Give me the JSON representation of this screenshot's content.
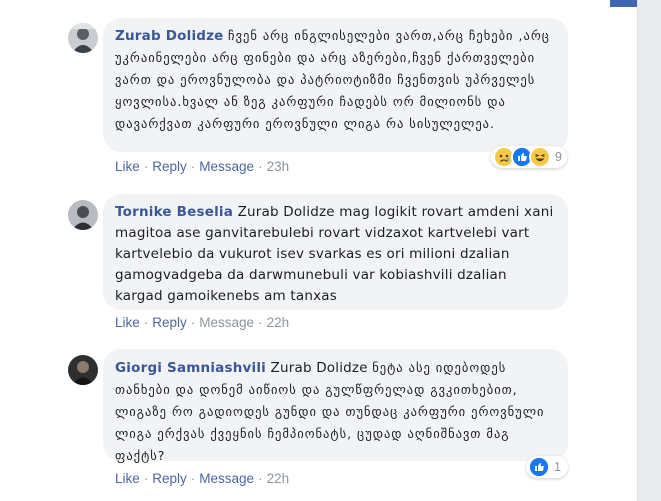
{
  "comments": [
    {
      "author": "Zurab Dolidze",
      "text": "ჩვენ არც ინგლისელები ვართ,არც ჩეხები ,არც უკრაინელები არც ფინები და არც აზერები,ჩვენ ქართველები ვართ და ეროვნულობა და პატრიოტიზმი ჩვენთვის უპრველეს ყოვლისა.ხვალ ან ზეგ კარფური ჩადებს ორ მილიონს და დავარქვათ კარფური ეროვნული ლიგა რა სისულელეა.",
      "actions": {
        "like": "Like",
        "reply": "Reply",
        "message": "Message",
        "time": "23h"
      },
      "reactions": {
        "icons": [
          "sad-icon",
          "like-icon",
          "haha-icon"
        ],
        "count": "9"
      }
    },
    {
      "author": "Tornike Beselia",
      "reference": "Zurab Dolidze",
      "text": "mag logikit rovart amdeni xani magitoa ase ganvitarebulebi rovart vidzaxot kartvelebi vart kartvelebio da vukurot isev svarkas es ori milioni dzalian gamogvadgeba da darwmunebuli var kobiashvili dzalian kargad gamoikenebs am tanxas",
      "actions": {
        "like": "Like",
        "reply": "Reply",
        "message": "Message",
        "time": "22h"
      }
    },
    {
      "author": "Giorgi Samniashvili",
      "reference": "Zurab Dolidze",
      "text": "ნეტა ასე იდებოდეს თანხები და დონემ აიწიოს და გულწფრელად გვკითხებით, ლიგაზე რო გადიოდეს გუნდი და თუნდაც კარფური ეროვნული ლიგა ერქვას ქვეყნის ჩემპიონატს, ცუდად აღნიშნავთ მაგ ფაქტს?",
      "actions": {
        "like": "Like",
        "reply": "Reply",
        "message": "Message",
        "time": "22h"
      },
      "reactions": {
        "icons": [
          "like-icon"
        ],
        "count": "1"
      }
    }
  ],
  "colors": {
    "author": "#385898",
    "link": "#4b67a1",
    "bubble": "#f2f3f5",
    "muted": "#8d949e"
  }
}
